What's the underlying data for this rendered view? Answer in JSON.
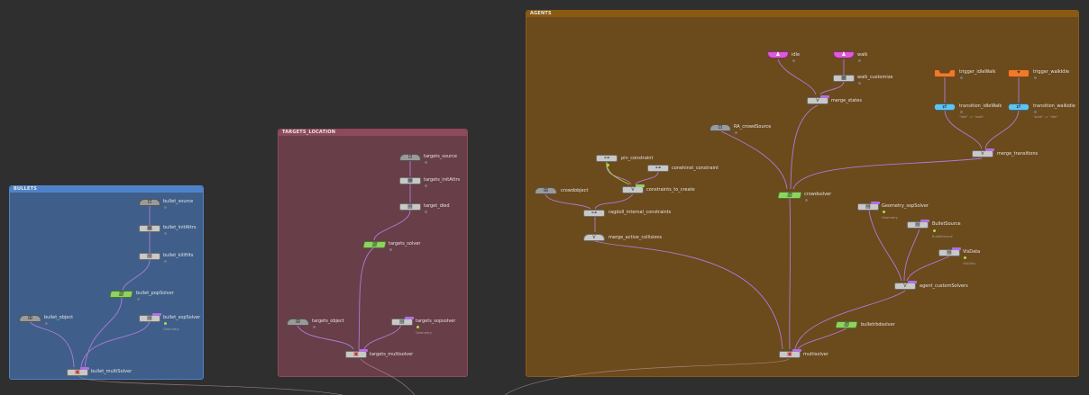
{
  "colors": {
    "background": "#2f2f2f",
    "bullets_box": "#3f5f8a",
    "bullets_bar": "#4f83c9",
    "targets_box": "#683e48",
    "targets_bar": "#8d4a5a",
    "agents_box": "#6b4a1c",
    "agents_bar": "#8a5a12",
    "wire": "#b07ad8",
    "wire_light": "#d8a8b0"
  },
  "network_boxes": {
    "bullets": {
      "title": "BULLETS"
    },
    "targets": {
      "title": "TARGETS_LOCATION"
    },
    "agents": {
      "title": "AGENTS"
    }
  },
  "nodes": {
    "bullet_source": {
      "label": "bullet_source",
      "icon": "source-icon"
    },
    "bullet_initattrs": {
      "label": "bullet_initAttrs",
      "icon": "wrangle-icon"
    },
    "bullet_killhits": {
      "label": "bullet_killHits",
      "icon": "sop-icon"
    },
    "bullet_popsolver": {
      "label": "bullet_popSolver",
      "icon": "pop-icon"
    },
    "bullet_object": {
      "label": "bullet_object",
      "icon": "object-icon"
    },
    "bullet_sopsolver": {
      "label": "bullet_sopSolver",
      "icon": "sop-icon",
      "sub": "Geometry"
    },
    "bullet_multisolver": {
      "label": "bullet_multiSolver",
      "icon": "multisolver-icon"
    },
    "targets_source": {
      "label": "targets_source",
      "icon": "source-icon"
    },
    "targets_initattrs": {
      "label": "targets_initAttrs",
      "icon": "wrangle-icon"
    },
    "target_died": {
      "label": "target_died",
      "icon": "sop-icon"
    },
    "targets_solver": {
      "label": "targets_solver",
      "icon": "pop-icon"
    },
    "targets_object": {
      "label": "targets_object",
      "icon": "object-icon"
    },
    "targets_sopsolver": {
      "label": "targets_sopsolver",
      "icon": "sop-icon",
      "sub": "Geometry"
    },
    "targets_multisolver": {
      "label": "targets_multisolver",
      "icon": "multisolver-icon"
    },
    "idle": {
      "label": "idle",
      "icon": "state-icon"
    },
    "walk": {
      "label": "walk",
      "icon": "state-icon"
    },
    "walk_customize": {
      "label": "walk_customize",
      "icon": "wrangle-icon"
    },
    "merge_states": {
      "label": "merge_states",
      "icon": "merge-icon"
    },
    "trigger_idlewalk": {
      "label": "trigger_idleWalk",
      "icon": "trigger-icon"
    },
    "trigger_walkidle": {
      "label": "trigger_walkIdle",
      "icon": "trigger-icon"
    },
    "transition_idlewalk": {
      "label": "transition_idleWalk",
      "icon": "transition-icon",
      "sub": "\"idle\" -> \"walk\""
    },
    "transition_walkidle": {
      "label": "transition_walkidle",
      "icon": "transition-icon",
      "sub": "\"walk\" -> \"idle\""
    },
    "merge_transitions": {
      "label": "merge_transitions",
      "icon": "merge-icon"
    },
    "ra_crowdsource": {
      "label": "RA_crowdSource",
      "icon": "source-icon"
    },
    "pin_constraint": {
      "label": "pin_constraint",
      "icon": "constraint-icon"
    },
    "conehinst_constraint": {
      "label": "conehinst_constraint",
      "icon": "constraint-icon"
    },
    "constraints_to_create": {
      "label": "constraints_to_create",
      "icon": "merge-icon"
    },
    "crowdobject": {
      "label": "crowdobject",
      "icon": "object-icon"
    },
    "crowdsolver": {
      "label": "crowdsolver",
      "icon": "solver-icon"
    },
    "ragdoll_internal_constraints": {
      "label": "ragdoll_internal_constraints",
      "icon": "constraint-icon"
    },
    "merge_active_collisions": {
      "label": "merge_active_collisions",
      "icon": "merge-icon"
    },
    "geometry_sopsolver": {
      "label": "Geometry_sopSolver",
      "icon": "sop-icon",
      "sub": "Geometry"
    },
    "bulletsource": {
      "label": "BulletSource",
      "icon": "sop-icon",
      "sub": "BulletSource"
    },
    "visdata": {
      "label": "VisData",
      "icon": "sop-icon",
      "sub": "VisData"
    },
    "agent_customsolvers": {
      "label": "agent_customSolvers",
      "icon": "merge-icon"
    },
    "bulletrbdsolver": {
      "label": "bulletrbdsolver",
      "icon": "solver-icon"
    },
    "multisolver": {
      "label": "multisolver",
      "icon": "multisolver-icon"
    }
  }
}
